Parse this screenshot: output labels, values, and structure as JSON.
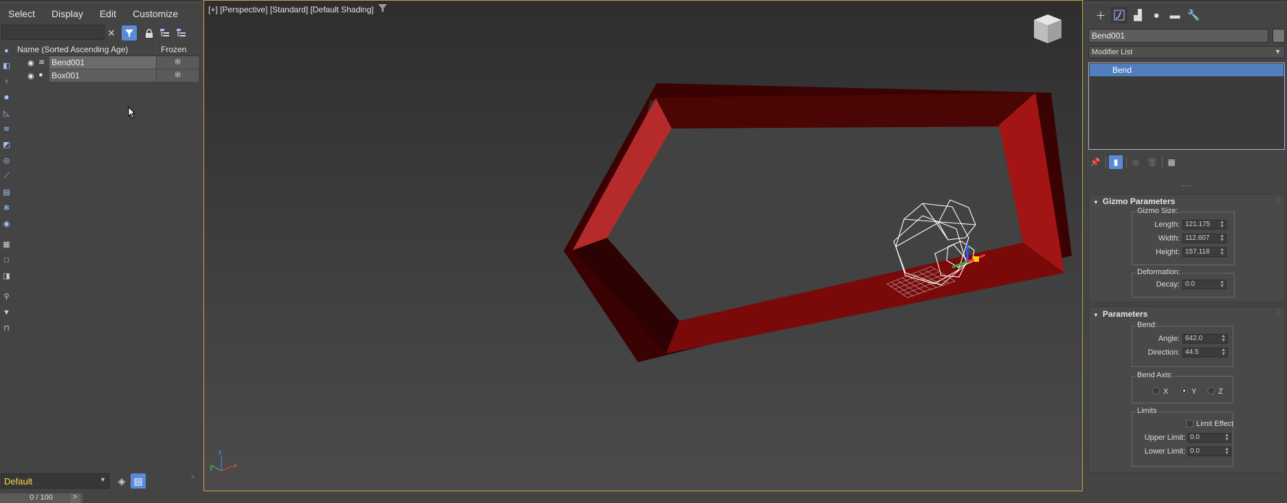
{
  "menu": [
    "Select",
    "Display",
    "Edit",
    "Customize"
  ],
  "explorer": {
    "search_placeholder": "",
    "columns": {
      "name": "Name (Sorted Ascending Age)",
      "frozen": "Frozen"
    },
    "rows": [
      {
        "name": "Bend001",
        "type_icon": "modifier-icon",
        "frozen_icon": "snowflake-icon"
      },
      {
        "name": "Box001",
        "type_icon": "geometry-dot-icon",
        "frozen_icon": "snowflake-icon"
      }
    ]
  },
  "layer": {
    "current": "Default"
  },
  "timeline": {
    "value": "0 / 100",
    "next": ">"
  },
  "viewport": {
    "label": "[+] [Perspective] [Standard] [Default Shading]",
    "accent_color": "#c9a43a",
    "object_color": "#8b0f0f"
  },
  "command_panel": {
    "tabs": [
      "create-icon",
      "modify-icon",
      "hierarchy-icon",
      "motion-icon",
      "display-icon",
      "utilities-icon"
    ],
    "object_name": "Bend001",
    "modifier_list": "Modifier List",
    "stack": [
      "Bend"
    ],
    "stack_tools": [
      "pin-icon",
      "show-end-result-icon",
      "make-unique-icon",
      "remove-modifier-icon",
      "configure-sets-icon"
    ]
  },
  "gizmo": {
    "title": "Gizmo Parameters",
    "size_label": "Gizmo Size:",
    "length_label": "Length:",
    "length": "121.175",
    "width_label": "Width:",
    "width": "112.607",
    "height_label": "Height:",
    "height": "157.118",
    "deformation_label": "Deformation:",
    "decay_label": "Decay:",
    "decay": "0.0"
  },
  "parameters": {
    "title": "Parameters",
    "bend_label": "Bend:",
    "angle_label": "Angle:",
    "angle": "642.0",
    "direction_label": "Direction:",
    "direction": "44.5",
    "axis_label": "Bend Axis:",
    "axes": [
      "X",
      "Y",
      "Z"
    ],
    "selected_axis": "Y",
    "limits_label": "Limits",
    "limit_effect": "Limit Effect",
    "upper_label": "Upper Limit:",
    "upper": "0.0",
    "lower_label": "Lower Limit:",
    "lower": "0.0"
  }
}
